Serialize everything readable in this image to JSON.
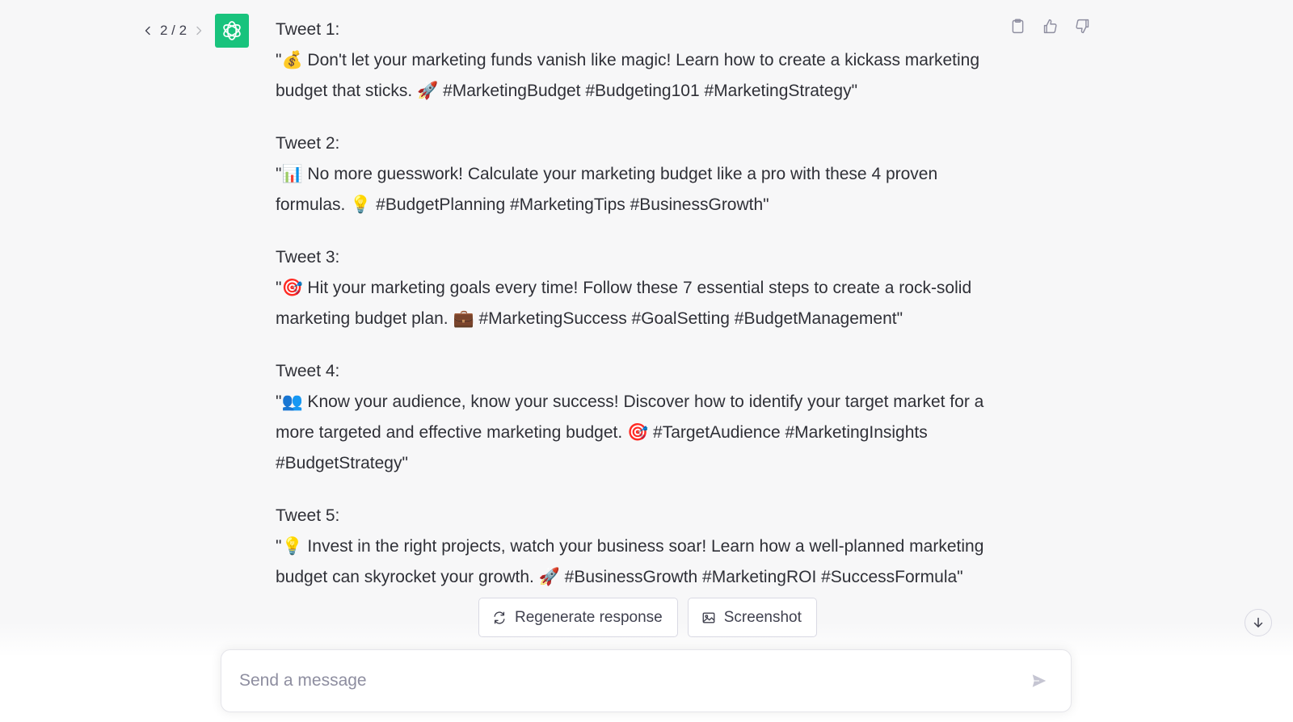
{
  "pager": {
    "label": "2 / 2"
  },
  "assistant": {
    "avatar_icon": "openai-logo-icon",
    "avatar_color": "#19c37d"
  },
  "tweets": [
    {
      "heading": "Tweet 1:",
      "body": "\"💰 Don't let your marketing funds vanish like magic! Learn how to create a kickass marketing budget that sticks. 🚀 #MarketingBudget #Budgeting101 #MarketingStrategy\""
    },
    {
      "heading": "Tweet 2:",
      "body": "\"📊 No more guesswork! Calculate your marketing budget like a pro with these 4 proven formulas. 💡 #BudgetPlanning #MarketingTips #BusinessGrowth\""
    },
    {
      "heading": "Tweet 3:",
      "body": "\"🎯 Hit your marketing goals every time! Follow these 7 essential steps to create a rock-solid marketing budget plan. 💼 #MarketingSuccess #GoalSetting #BudgetManagement\""
    },
    {
      "heading": "Tweet 4:",
      "body": "\"👥 Know your audience, know your success! Discover how to identify your target market for a more targeted and effective marketing budget. 🎯 #TargetAudience #MarketingInsights #BudgetStrategy\""
    },
    {
      "heading": "Tweet 5:",
      "body": "\"💡 Invest in the right projects, watch your business soar! Learn how a well-planned marketing budget can skyrocket your growth. 🚀 #BusinessGrowth #MarketingROI #SuccessFormula\""
    }
  ],
  "feedback": {
    "icons": [
      "clipboard-icon",
      "thumbs-up-icon",
      "thumbs-down-icon"
    ]
  },
  "actions": {
    "regenerate_label": "Regenerate response",
    "screenshot_label": "Screenshot"
  },
  "composer": {
    "placeholder": "Send a message",
    "value": ""
  }
}
